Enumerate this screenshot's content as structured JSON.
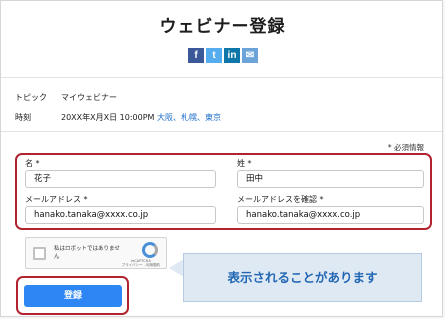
{
  "page": {
    "title": "ウェビナー登録"
  },
  "share": [
    {
      "icon": "facebook-icon",
      "glyph": "f"
    },
    {
      "icon": "twitter-icon",
      "glyph": "t"
    },
    {
      "icon": "linkedin-icon",
      "glyph": "in"
    },
    {
      "icon": "mail-icon",
      "glyph": "✉"
    }
  ],
  "info": {
    "topic_label": "トピック",
    "topic_value": "マイウェビナー",
    "time_label": "時刻",
    "time_value": "20XX年X月X日 10:00PM",
    "timezones": "大阪、札幌、東京"
  },
  "form": {
    "required_note": "* 必須情報",
    "first_name_label": "名 *",
    "first_name_value": "花子",
    "last_name_label": "姓 *",
    "last_name_value": "田中",
    "email_label": "メールアドレス *",
    "email_value": "hanako.tanaka@xxxx.co.jp",
    "email_confirm_label": "メールアドレスを確認 *",
    "email_confirm_value": "hanako.tanaka@xxxx.co.jp",
    "submit_label": "登録"
  },
  "captcha": {
    "text": "私はロボットではありません",
    "brand": "reCAPTCHA",
    "links": "プライバシー - 利用規約"
  },
  "callout": {
    "text": "表示されることがあります"
  },
  "colors": {
    "accent": "#2d86f3",
    "highlight": "#b1242f",
    "callout_bg": "#dfe9f4",
    "callout_text": "#2267b3"
  }
}
